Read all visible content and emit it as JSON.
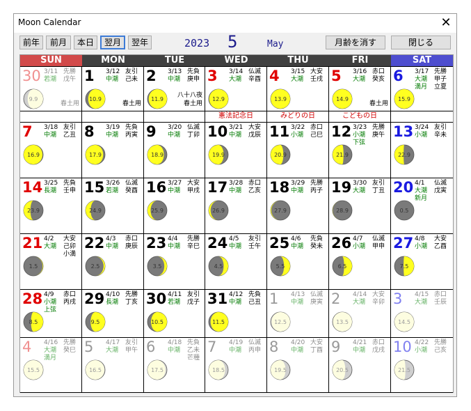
{
  "window": {
    "title": "Moon Calendar",
    "close_glyph": "✕"
  },
  "toolbar": {
    "prev_year": "前年",
    "prev_month": "前月",
    "today": "本日",
    "next_month": "翌月",
    "next_year": "翌年",
    "hide_moon_age": "月齢を消す",
    "close": "閉じる"
  },
  "header": {
    "year": "2023",
    "month": "5",
    "month_name": "May"
  },
  "weekdays": [
    "SUN",
    "MON",
    "TUE",
    "WED",
    "THU",
    "FRI",
    "SAT"
  ],
  "colors": {
    "sun_header": "#d24a4a",
    "weekday_header": "#404040",
    "sat_header": "#4e4ecf",
    "sunday": "#e00000",
    "saturday": "#1a1ae0",
    "weekday": "#000000",
    "moon_fill": "#ffff20",
    "moon_dark": "#7a7a7a",
    "holiday": "#d00000",
    "tide": "#007a00"
  },
  "weeks": [
    [
      {
        "day": "30",
        "other": true,
        "lunar": "3/11",
        "rokuyo": "先勝",
        "tide": "若潮",
        "kanshi": "戊午",
        "age": "9.9",
        "phase": 0.35,
        "notes": [
          {
            "text": "春土用",
            "pos": "bottom-right"
          }
        ]
      },
      {
        "day": "1",
        "lunar": "3/12",
        "rokuyo": "友引",
        "tide": "中潮",
        "kanshi": "己未",
        "age": "10.9",
        "phase": 0.38,
        "notes": [
          {
            "text": "春土用",
            "pos": "bottom-right"
          }
        ]
      },
      {
        "day": "2",
        "lunar": "3/13",
        "rokuyo": "先負",
        "tide": "中潮",
        "kanshi": "庚申",
        "age": "11.9",
        "phase": 0.42,
        "notes": [
          {
            "text": "八十八夜",
            "pos": "mid-right"
          },
          {
            "text": "春土用",
            "pos": "bottom-right"
          }
        ]
      },
      {
        "day": "3",
        "lunar": "3/14",
        "rokuyo": "仏滅",
        "tide": "大潮",
        "kanshi": "辛酉",
        "age": "12.9",
        "phase": 0.45,
        "notes": [],
        "holiday": "憲法記念日"
      },
      {
        "day": "4",
        "lunar": "3/15",
        "rokuyo": "大安",
        "tide": "大潮",
        "kanshi": "壬戌",
        "age": "13.9",
        "phase": 0.48,
        "notes": [],
        "holiday": "みどりの日"
      },
      {
        "day": "5",
        "lunar": "3/16",
        "rokuyo": "赤口",
        "tide": "大潮",
        "kanshi": "癸亥",
        "age": "14.9",
        "phase": 0.5,
        "notes": [
          {
            "text": "春土用",
            "pos": "bottom-right"
          }
        ],
        "holiday": "こどもの日"
      },
      {
        "day": "6",
        "lunar": "3/17",
        "rokuyo": "先勝",
        "tide": "大潮",
        "kanshi": "甲子",
        "age": "15.9",
        "phase": 0.52,
        "notes": [
          {
            "text": "満月",
            "pos": "row3-left",
            "green": true
          },
          {
            "text": "立夏",
            "pos": "row3-right"
          }
        ]
      }
    ],
    [
      {
        "day": "7",
        "lunar": "3/18",
        "rokuyo": "友引",
        "tide": "中潮",
        "kanshi": "乙丑",
        "age": "16.9",
        "phase": 0.56,
        "notes": []
      },
      {
        "day": "8",
        "lunar": "3/19",
        "rokuyo": "先負",
        "tide": "中潮",
        "kanshi": "丙寅",
        "age": "17.9",
        "phase": 0.6,
        "notes": []
      },
      {
        "day": "9",
        "lunar": "3/20",
        "rokuyo": "仏滅",
        "tide": "中潮",
        "kanshi": "丁卯",
        "age": "18.9",
        "phase": 0.63,
        "notes": []
      },
      {
        "day": "10",
        "lunar": "3/21",
        "rokuyo": "大安",
        "tide": "中潮",
        "kanshi": "戊辰",
        "age": "19.9",
        "phase": 0.66,
        "notes": []
      },
      {
        "day": "11",
        "lunar": "3/22",
        "rokuyo": "赤口",
        "tide": "小潮",
        "kanshi": "己巳",
        "age": "20.9",
        "phase": 0.7,
        "notes": []
      },
      {
        "day": "12",
        "lunar": "3/23",
        "rokuyo": "先勝",
        "tide": "小潮",
        "kanshi": "庚午",
        "age": "21.9",
        "phase": 0.73,
        "notes": [
          {
            "text": "下弦",
            "pos": "row3-left",
            "green": true
          }
        ]
      },
      {
        "day": "13",
        "lunar": "3/24",
        "rokuyo": "友引",
        "tide": "小潮",
        "kanshi": "辛未",
        "age": "22.9",
        "phase": 0.76,
        "notes": []
      }
    ],
    [
      {
        "day": "14",
        "lunar": "3/25",
        "rokuyo": "先負",
        "tide": "長潮",
        "kanshi": "壬申",
        "age": "23.9",
        "phase": 0.8,
        "notes": []
      },
      {
        "day": "15",
        "lunar": "3/26",
        "rokuyo": "仏滅",
        "tide": "若潮",
        "kanshi": "癸酉",
        "age": "24.9",
        "phase": 0.83,
        "notes": []
      },
      {
        "day": "16",
        "lunar": "3/27",
        "rokuyo": "大安",
        "tide": "中潮",
        "kanshi": "甲戌",
        "age": "25.9",
        "phase": 0.87,
        "notes": []
      },
      {
        "day": "17",
        "lunar": "3/28",
        "rokuyo": "赤口",
        "tide": "中潮",
        "kanshi": "乙亥",
        "age": "26.9",
        "phase": 0.9,
        "notes": []
      },
      {
        "day": "18",
        "lunar": "3/29",
        "rokuyo": "先勝",
        "tide": "中潮",
        "kanshi": "丙子",
        "age": "27.9",
        "phase": 0.94,
        "notes": []
      },
      {
        "day": "19",
        "lunar": "3/30",
        "rokuyo": "友引",
        "tide": "大潮",
        "kanshi": "丁丑",
        "age": "28.9",
        "phase": 0.97,
        "notes": []
      },
      {
        "day": "20",
        "lunar": "4/1",
        "rokuyo": "仏滅",
        "tide": "大潮",
        "kanshi": "戊寅",
        "age": "0.5",
        "phase": 0.0,
        "notes": [
          {
            "text": "新月",
            "pos": "row3-left",
            "green": true
          }
        ]
      }
    ],
    [
      {
        "day": "21",
        "lunar": "4/2",
        "rokuyo": "大安",
        "tide": "大潮",
        "kanshi": "己卯",
        "age": "1.5",
        "phase": 0.05,
        "notes": [
          {
            "text": "小満",
            "pos": "row3-right"
          }
        ]
      },
      {
        "day": "22",
        "lunar": "4/3",
        "rokuyo": "赤口",
        "tide": "中潮",
        "kanshi": "庚辰",
        "age": "2.5",
        "phase": 0.09,
        "notes": []
      },
      {
        "day": "23",
        "lunar": "4/4",
        "rokuyo": "先勝",
        "tide": "中潮",
        "kanshi": "辛巳",
        "age": "3.5",
        "phase": 0.12,
        "notes": []
      },
      {
        "day": "24",
        "lunar": "4/5",
        "rokuyo": "友引",
        "tide": "中潮",
        "kanshi": "壬午",
        "age": "4.5",
        "phase": 0.16,
        "notes": []
      },
      {
        "day": "25",
        "lunar": "4/6",
        "rokuyo": "先負",
        "tide": "中潮",
        "kanshi": "癸未",
        "age": "5.5",
        "phase": 0.19,
        "notes": []
      },
      {
        "day": "26",
        "lunar": "4/7",
        "rokuyo": "仏滅",
        "tide": "小潮",
        "kanshi": "甲申",
        "age": "6.5",
        "phase": 0.22,
        "notes": []
      },
      {
        "day": "27",
        "lunar": "4/8",
        "rokuyo": "大安",
        "tide": "小潮",
        "kanshi": "乙酉",
        "age": "7.5",
        "phase": 0.26,
        "notes": []
      }
    ],
    [
      {
        "day": "28",
        "lunar": "4/9",
        "rokuyo": "赤口",
        "tide": "小潮",
        "kanshi": "丙戌",
        "age": "8.5",
        "phase": 0.29,
        "notes": [
          {
            "text": "上弦",
            "pos": "row3-left",
            "green": true
          }
        ]
      },
      {
        "day": "29",
        "lunar": "4/10",
        "rokuyo": "先勝",
        "tide": "長潮",
        "kanshi": "丁亥",
        "age": "9.5",
        "phase": 0.33,
        "notes": []
      },
      {
        "day": "30",
        "lunar": "4/11",
        "rokuyo": "友引",
        "tide": "若潮",
        "kanshi": "戊子",
        "age": "10.5",
        "phase": 0.36,
        "notes": []
      },
      {
        "day": "31",
        "lunar": "4/12",
        "rokuyo": "先負",
        "tide": "中潮",
        "kanshi": "己丑",
        "age": "11.5",
        "phase": 0.4,
        "notes": []
      },
      {
        "day": "1",
        "other": true,
        "lunar": "4/13",
        "rokuyo": "仏滅",
        "tide": "中潮",
        "kanshi": "庚寅",
        "age": "12.5",
        "phase": 0.43,
        "notes": []
      },
      {
        "day": "2",
        "other": true,
        "lunar": "4/14",
        "rokuyo": "大安",
        "tide": "大潮",
        "kanshi": "辛卯",
        "age": "13.5",
        "phase": 0.46,
        "notes": []
      },
      {
        "day": "3",
        "other": true,
        "lunar": "4/15",
        "rokuyo": "赤口",
        "tide": "大潮",
        "kanshi": "壬辰",
        "age": "14.5",
        "phase": 0.5,
        "notes": []
      }
    ],
    [
      {
        "day": "4",
        "other": true,
        "lunar": "4/16",
        "rokuyo": "先勝",
        "tide": "大潮",
        "kanshi": "癸巳",
        "age": "15.5",
        "phase": 0.52,
        "notes": [
          {
            "text": "満月",
            "pos": "row3-left",
            "green": true
          }
        ]
      },
      {
        "day": "5",
        "other": true,
        "lunar": "4/17",
        "rokuyo": "友引",
        "tide": "大潮",
        "kanshi": "甲午",
        "age": "16.5",
        "phase": 0.56,
        "notes": []
      },
      {
        "day": "6",
        "other": true,
        "lunar": "4/18",
        "rokuyo": "先負",
        "tide": "中潮",
        "kanshi": "乙未",
        "age": "17.5",
        "phase": 0.59,
        "notes": [
          {
            "text": "芒種",
            "pos": "row3-right"
          }
        ]
      },
      {
        "day": "7",
        "other": true,
        "lunar": "4/19",
        "rokuyo": "仏滅",
        "tide": "中潮",
        "kanshi": "丙申",
        "age": "18.5",
        "phase": 0.63,
        "notes": []
      },
      {
        "day": "8",
        "other": true,
        "lunar": "4/20",
        "rokuyo": "大安",
        "tide": "中潮",
        "kanshi": "丁酉",
        "age": "19.5",
        "phase": 0.66,
        "notes": []
      },
      {
        "day": "9",
        "other": true,
        "lunar": "4/21",
        "rokuyo": "赤口",
        "tide": "中潮",
        "kanshi": "戊戌",
        "age": "20.5",
        "phase": 0.7,
        "notes": []
      },
      {
        "day": "10",
        "other": true,
        "lunar": "4/22",
        "rokuyo": "先勝",
        "tide": "小潮",
        "kanshi": "己亥",
        "age": "21.5",
        "phase": 0.73,
        "notes": []
      }
    ]
  ]
}
